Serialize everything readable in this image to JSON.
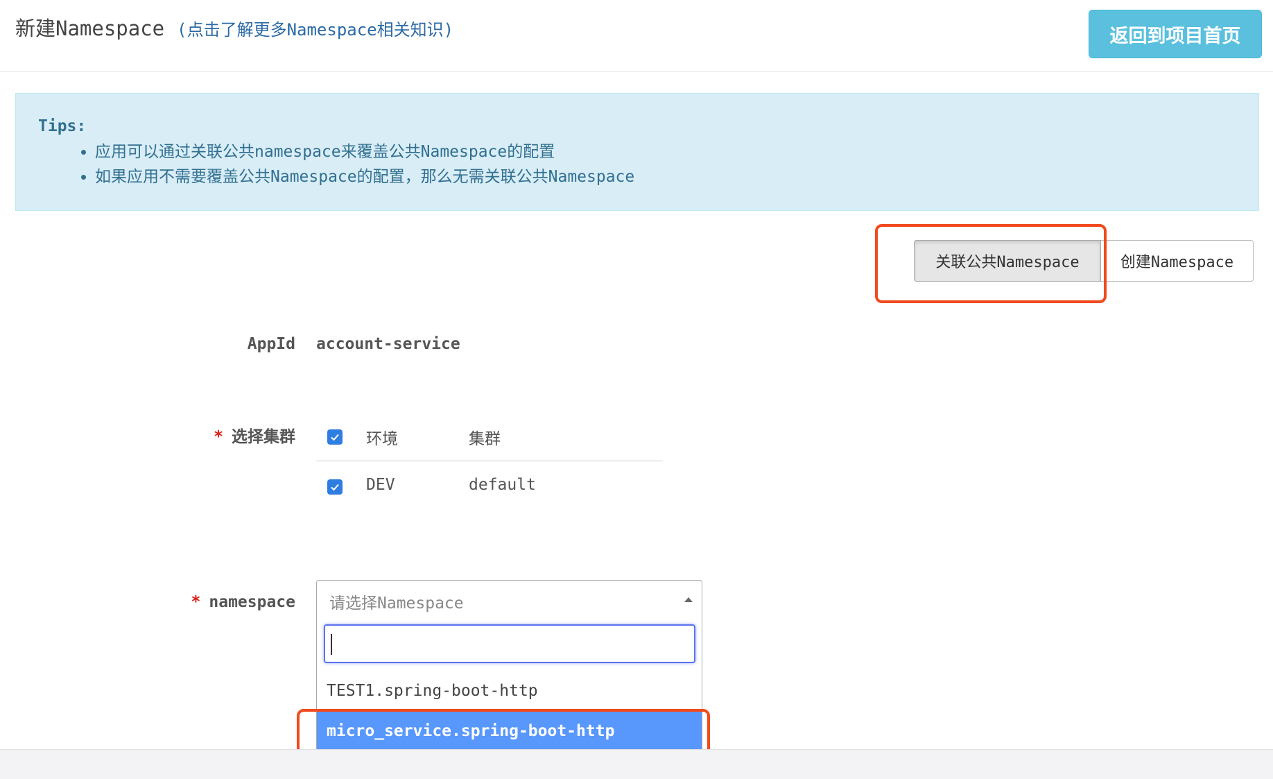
{
  "header": {
    "title": "新建Namespace",
    "learn_more": "(点击了解更多Namespace相关知识)",
    "back_button": "返回到项目首页"
  },
  "tips": {
    "title": "Tips:",
    "items": [
      "应用可以通过关联公共namespace来覆盖公共Namespace的配置",
      "如果应用不需要覆盖公共Namespace的配置，那么无需关联公共Namespace"
    ]
  },
  "mode_buttons": {
    "associate": "关联公共Namespace",
    "create": "创建Namespace"
  },
  "form": {
    "appid_label": "AppId",
    "appid_value": "account-service",
    "required_mark": "*",
    "cluster_label": "选择集群",
    "cluster_table": {
      "headers": [
        "环境",
        "集群"
      ],
      "rows": [
        {
          "env": "DEV",
          "cluster": "default",
          "checked": true
        }
      ]
    },
    "namespace_label": "namespace",
    "namespace_select": {
      "placeholder": "请选择Namespace",
      "search_value": "",
      "options": [
        "TEST1.spring-boot-http",
        "micro_service.spring-boot-http"
      ],
      "highlighted": "micro_service.spring-boot-http"
    }
  },
  "colors": {
    "info_bg": "#d9edf7",
    "info_text": "#31708f",
    "primary_info": "#5bc0de",
    "checkbox": "#2f7de1",
    "option_highlight": "#5897fb",
    "annotation_red": "#f04a1e"
  }
}
